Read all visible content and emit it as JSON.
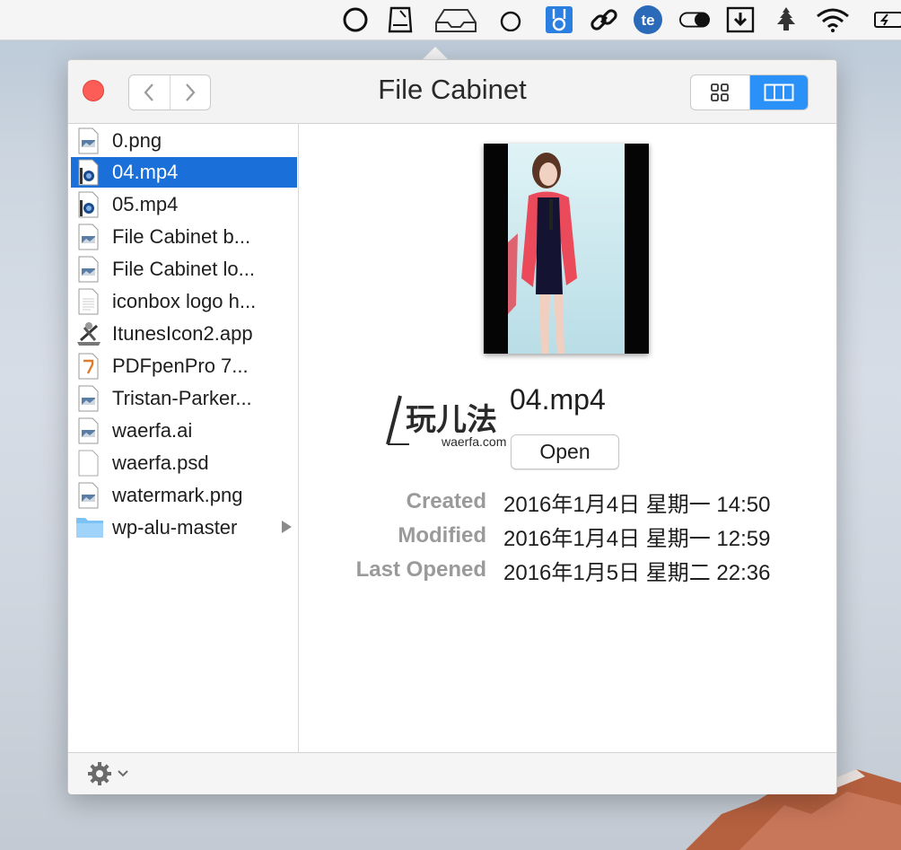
{
  "app": {
    "title": "File Cabinet"
  },
  "files": [
    {
      "name": "0.png",
      "type": "image"
    },
    {
      "name": "04.mp4",
      "type": "video",
      "selected": true
    },
    {
      "name": "05.mp4",
      "type": "video"
    },
    {
      "name": "File Cabinet b...",
      "type": "image"
    },
    {
      "name": "File Cabinet lo...",
      "type": "image"
    },
    {
      "name": "iconbox logo h...",
      "type": "document"
    },
    {
      "name": "ItunesIcon2.app",
      "type": "app"
    },
    {
      "name": "PDFpenPro 7...",
      "type": "pdf"
    },
    {
      "name": "Tristan-Parker...",
      "type": "image"
    },
    {
      "name": "waerfa.ai",
      "type": "image"
    },
    {
      "name": "waerfa.psd",
      "type": "document"
    },
    {
      "name": "watermark.png",
      "type": "image"
    },
    {
      "name": "wp-alu-master",
      "type": "folder"
    }
  ],
  "preview": {
    "filename": "04.mp4",
    "open_label": "Open",
    "watermark_text": "玩儿法",
    "watermark_site": "waerfa.com",
    "meta": [
      {
        "key": "Created",
        "value": "2016年1月4日 星期一 14:50"
      },
      {
        "key": "Modified",
        "value": "2016年1月4日 星期一 12:59"
      },
      {
        "key": "Last Opened",
        "value": "2016年1月5日 星期二 22:36"
      }
    ]
  },
  "menubar_icons": [
    "ring-icon",
    "device-icon",
    "tray-icon",
    "circle-icon",
    "bunny-icon",
    "link-icon",
    "te-icon",
    "toggle-icon",
    "download-icon",
    "tree-icon",
    "wifi-icon",
    "battery-icon"
  ],
  "colors": {
    "selection": "#1a6fd8",
    "accent": "#2a91f9",
    "close": "#fc5d57"
  }
}
